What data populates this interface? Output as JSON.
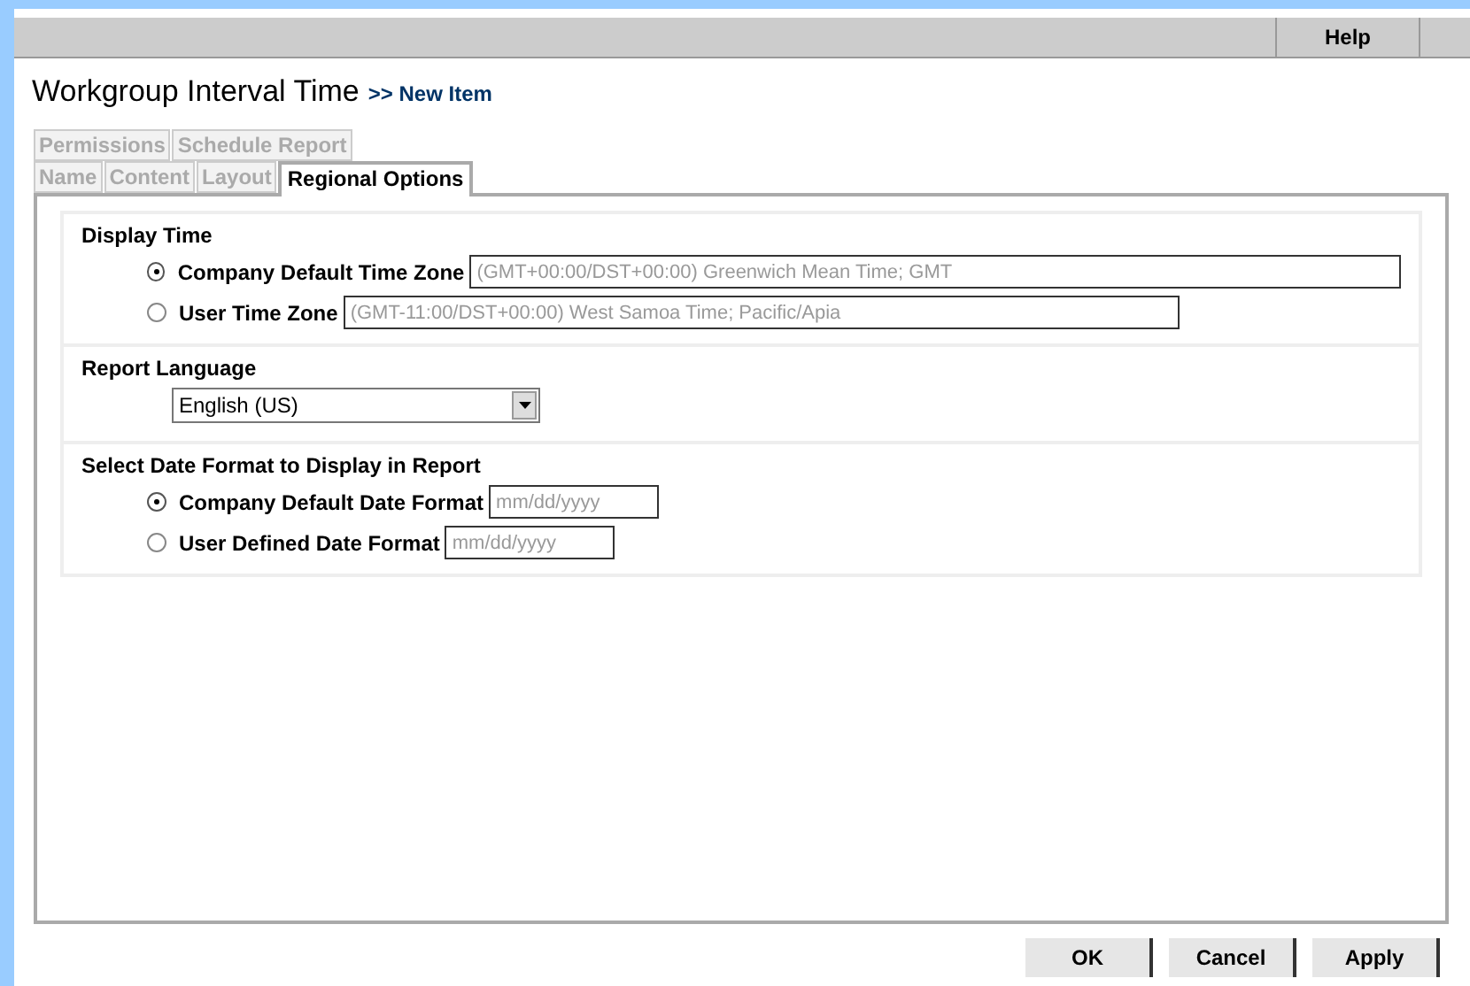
{
  "toolbar": {
    "buttons": [
      "Help"
    ]
  },
  "page": {
    "title": "Workgroup Interval Time",
    "breadcrumb": ">> New Item"
  },
  "tab_rows": [
    {
      "tabs": [
        {
          "label": "Permissions",
          "selected": false
        },
        {
          "label": "Schedule Report",
          "selected": false
        }
      ]
    },
    {
      "tabs": [
        {
          "label": "Name",
          "selected": false
        },
        {
          "label": "Content",
          "selected": false
        },
        {
          "label": "Layout",
          "selected": false
        },
        {
          "label": "Regional Options",
          "selected": true
        }
      ]
    }
  ],
  "sections": [
    {
      "title": "Display Time",
      "kind": "radios",
      "options": [
        {
          "label": "Company Default Time Zone",
          "selected": true,
          "placeholder": "(GMT+00:00/DST+00:00) Greenwich Mean Time; GMT"
        },
        {
          "label": "User Time Zone",
          "selected": false,
          "placeholder": "(GMT-11:00/DST+00:00) West Samoa Time; Pacific/Apia"
        }
      ]
    },
    {
      "title": "Report Language",
      "kind": "dropdown",
      "value": "English (US)"
    },
    {
      "title": "Select Date Format to Display in Report",
      "kind": "radios",
      "options": [
        {
          "label": "Company Default Date Format",
          "selected": true,
          "placeholder": "mm/dd/yyyy"
        },
        {
          "label": "User Defined Date Format",
          "selected": false,
          "placeholder": "mm/dd/yyyy"
        }
      ]
    }
  ],
  "buttons": [
    "OK",
    "Cancel",
    "Apply"
  ]
}
